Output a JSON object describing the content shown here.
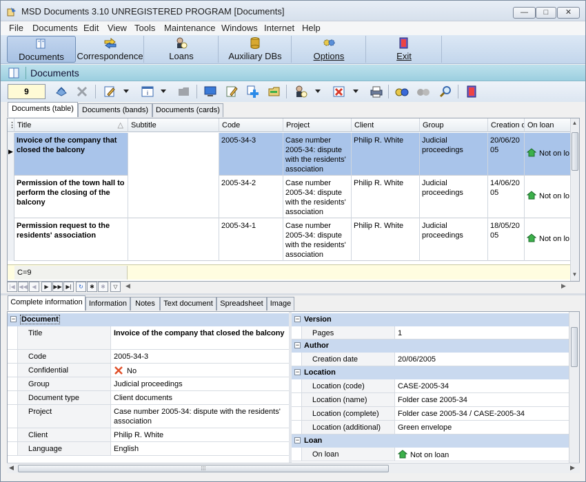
{
  "window": {
    "title": "MSD Documents 3.10 UNREGISTERED PROGRAM [Documents]",
    "btn_min": "—",
    "btn_max": "□",
    "btn_close": "✕"
  },
  "menu": [
    "File",
    "Documents",
    "Edit",
    "View",
    "Tools",
    "Maintenance",
    "Windows",
    "Internet",
    "Help"
  ],
  "modules": [
    {
      "label": "Documents",
      "icon": "documents-icon"
    },
    {
      "label": "Correspondence",
      "icon": "correspondence-icon"
    },
    {
      "label": "Loans",
      "icon": "loans-icon"
    },
    {
      "label": "Auxiliary DBs",
      "icon": "database-icon"
    },
    {
      "label": "Options",
      "icon": "options-icon"
    },
    {
      "label": "Exit",
      "icon": "exit-icon"
    }
  ],
  "section": {
    "title": "Documents"
  },
  "toolbar": {
    "record_count": "9"
  },
  "view_tabs": [
    "Documents (table)",
    "Documents (bands)",
    "Documents (cards)"
  ],
  "grid": {
    "columns": [
      "Title",
      "Subtitle",
      "Code",
      "Project",
      "Client",
      "Group",
      "Creation d",
      "On loan"
    ],
    "rows": [
      {
        "title": "Invoice of the company that closed the balcony",
        "subtitle": "",
        "code": "2005-34-3",
        "project": "Case number 2005-34: dispute with the residents' association",
        "client": "Philip R. White",
        "group": "Judicial proceedings",
        "date": "20/06/2005",
        "loan": "Not on lo"
      },
      {
        "title": "Permission of the town hall to perform the closing of the balcony",
        "subtitle": "",
        "code": "2005-34-2",
        "project": "Case number 2005-34: dispute with the residents' association",
        "client": "Philip R. White",
        "group": "Judicial proceedings",
        "date": "14/06/2005",
        "loan": "Not on lo"
      },
      {
        "title": "Permission request to the residents' association",
        "subtitle": "",
        "code": "2005-34-1",
        "project": "Case number 2005-34: dispute with the residents' association",
        "client": "Philip R. White",
        "group": "Judicial proceedings",
        "date": "18/05/2005",
        "loan": "Not on lo"
      }
    ],
    "footer_count": "C=9"
  },
  "detail_tabs": [
    "Complete information",
    "Information",
    "Notes",
    "Text document",
    "Spreadsheet",
    "Image"
  ],
  "details_left": {
    "category": "Document",
    "props": [
      {
        "name": "Title",
        "value": "Invoice of the company that closed the balcony"
      },
      {
        "name": "Code",
        "value": "2005-34-3"
      },
      {
        "name": "Confidential",
        "value": "No"
      },
      {
        "name": "Group",
        "value": "Judicial proceedings"
      },
      {
        "name": "Document type",
        "value": "Client documents"
      },
      {
        "name": "Project",
        "value": "Case number 2005-34: dispute with the residents' association"
      },
      {
        "name": "Client",
        "value": "Philip R. White"
      },
      {
        "name": "Language",
        "value": "English"
      }
    ]
  },
  "details_right": {
    "version": {
      "category": "Version",
      "props": [
        {
          "name": "Pages",
          "value": "1"
        }
      ]
    },
    "author": {
      "category": "Author",
      "props": [
        {
          "name": "Creation date",
          "value": "20/06/2005"
        }
      ]
    },
    "location": {
      "category": "Location",
      "props": [
        {
          "name": "Location (code)",
          "value": "CASE-2005-34"
        },
        {
          "name": "Location (name)",
          "value": "Folder case 2005-34"
        },
        {
          "name": "Location (complete)",
          "value": "Folder case 2005-34 / CASE-2005-34"
        },
        {
          "name": "Location (additional)",
          "value": "Green envelope"
        }
      ]
    },
    "loan": {
      "category": "Loan",
      "props": [
        {
          "name": "On loan",
          "value": "Not on loan"
        }
      ]
    }
  },
  "colors": {
    "selected_row": "#a9c4ea",
    "section_header": "#9ccfe0",
    "category": "#c9d9ef",
    "footer": "#fffde0"
  }
}
